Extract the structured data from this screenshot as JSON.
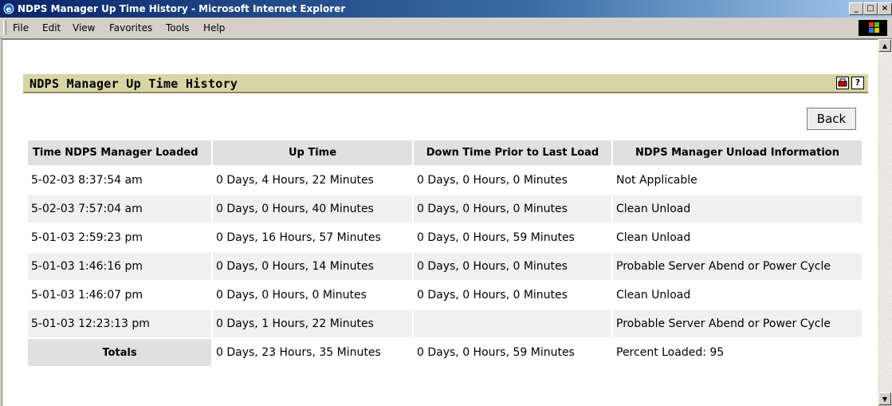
{
  "window": {
    "title": "NDPS Manager Up Time History - Microsoft Internet Explorer",
    "controls": [
      "_",
      "□",
      "×"
    ]
  },
  "menu": [
    {
      "label": "File"
    },
    {
      "label": "Edit"
    },
    {
      "label": "View"
    },
    {
      "label": "Favorites"
    },
    {
      "label": "Tools"
    },
    {
      "label": "Help"
    }
  ],
  "page": {
    "title": "NDPS Manager Up Time History",
    "help_icon": "?",
    "back_label": "Back"
  },
  "table": {
    "headers": [
      "Time NDPS Manager Loaded",
      "Up Time",
      "Down Time Prior to Last Load",
      "NDPS Manager Unload Information"
    ],
    "rows": [
      [
        "5-02-03 8:37:54 am",
        "0 Days, 4 Hours, 22 Minutes",
        "0 Days, 0 Hours, 0 Minutes",
        "Not Applicable"
      ],
      [
        "5-02-03 7:57:04 am",
        "0 Days, 0 Hours, 40 Minutes",
        "0 Days, 0 Hours, 0 Minutes",
        "Clean Unload"
      ],
      [
        "5-01-03 2:59:23 pm",
        "0 Days, 16 Hours, 57 Minutes",
        "0 Days, 0 Hours, 59 Minutes",
        "Clean Unload"
      ],
      [
        "5-01-03 1:46:16 pm",
        "0 Days, 0 Hours, 14 Minutes",
        "0 Days, 0 Hours, 0 Minutes",
        "Probable Server Abend or Power Cycle"
      ],
      [
        "5-01-03 1:46:07 pm",
        "0 Days, 0 Hours, 0 Minutes",
        "0 Days, 0 Hours, 0 Minutes",
        "Clean Unload"
      ],
      [
        "5-01-03 12:23:13 pm",
        "0 Days, 1 Hours, 22 Minutes",
        "",
        "Probable Server Abend or Power Cycle"
      ]
    ],
    "totals": [
      "Totals",
      "0 Days, 23 Hours, 35 Minutes",
      "0 Days, 0 Hours, 59 Minutes",
      "Percent Loaded: 95"
    ]
  }
}
